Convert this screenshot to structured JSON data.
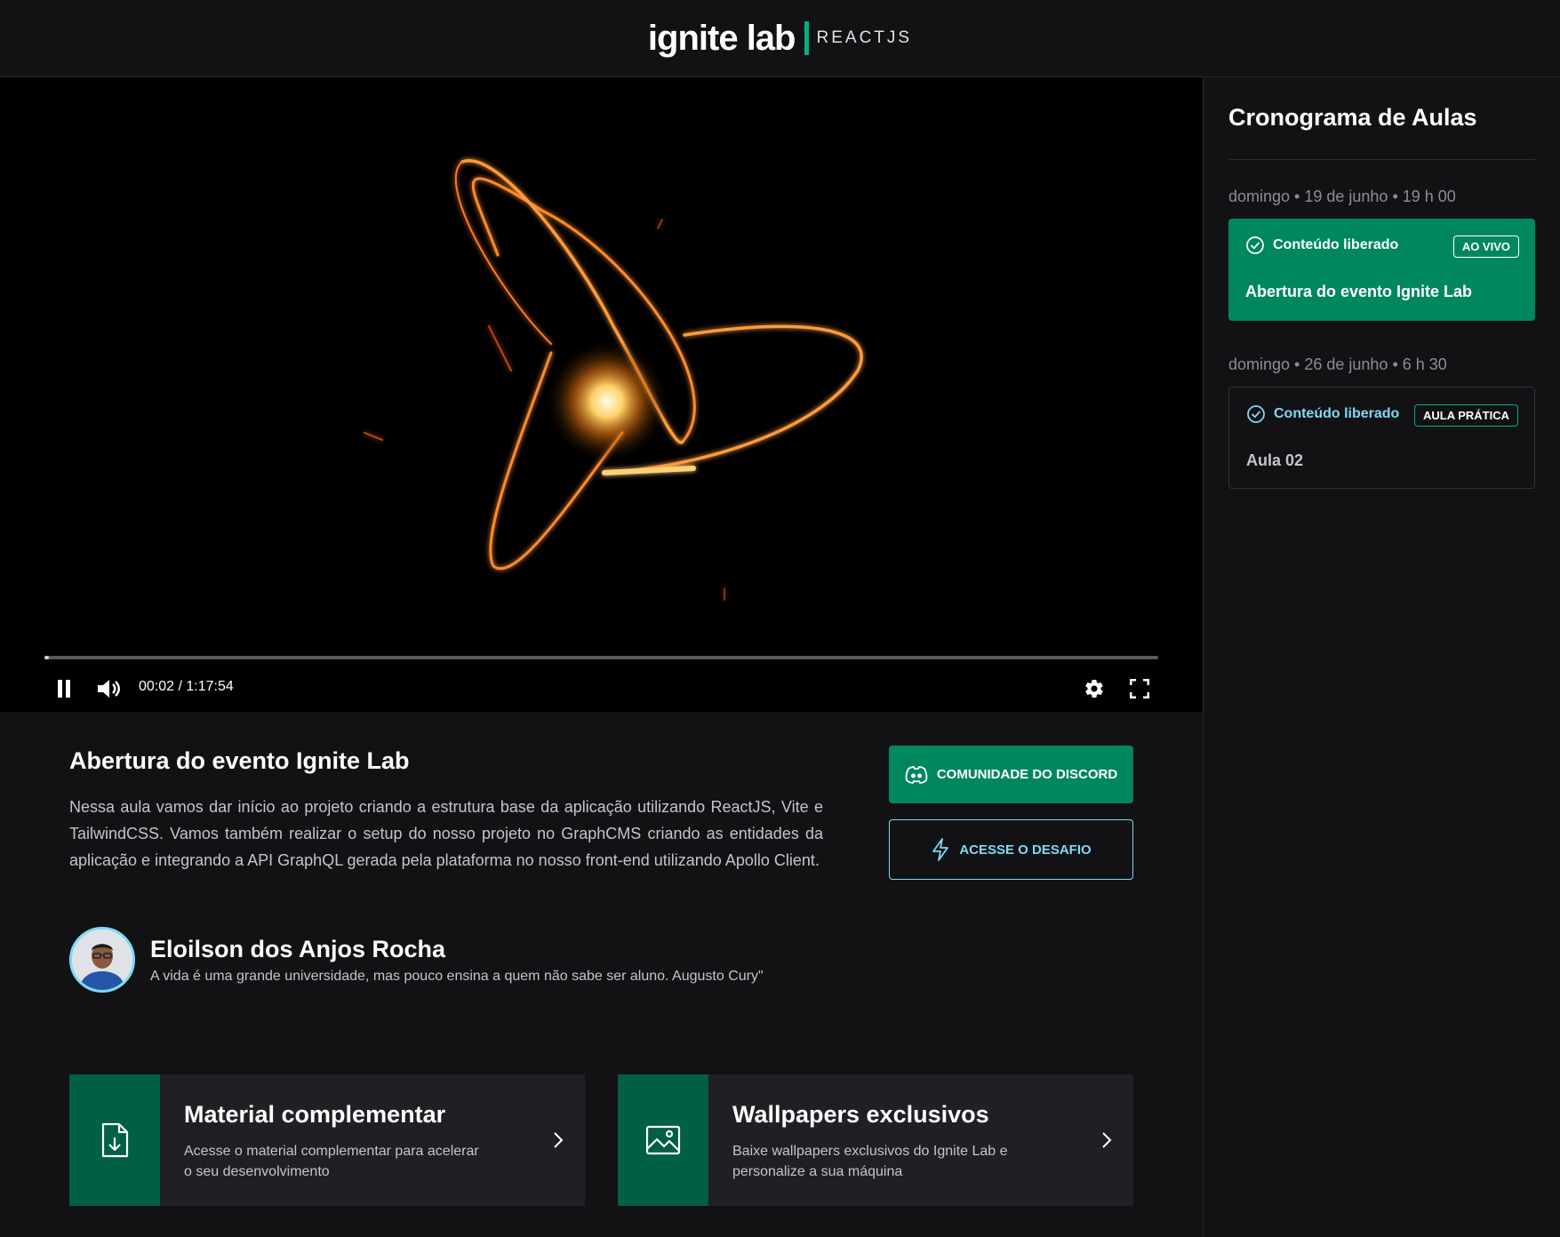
{
  "header": {
    "logo_main": "ignite lab",
    "logo_sub": "REACTJS"
  },
  "player": {
    "time_display": "00:02 / 1:17:54",
    "progress_fraction": 0.0003
  },
  "lesson": {
    "title": "Abertura do evento Ignite Lab",
    "description": "Nessa aula vamos dar início ao projeto criando a estrutura base da aplicação utilizando ReactJS, Vite e TailwindCSS. Vamos também realizar o setup do nosso projeto no GraphCMS criando as entidades da aplicação e integrando a API GraphQL gerada pela plataforma no nosso front-end utilizando Apollo Client."
  },
  "actions": {
    "discord_label": "COMUNIDADE DO DISCORD",
    "challenge_label": "ACESSE O DESAFIO"
  },
  "teacher": {
    "name": "Eloilson dos Anjos Rocha",
    "bio": "A vida é uma grande universidade, mas pouco ensina a quem não sabe ser aluno. Augusto Cury\""
  },
  "cards": [
    {
      "title": "Material complementar",
      "description": "Acesse o material complementar para acelerar o seu desenvolvimento",
      "icon": "file-download-icon"
    },
    {
      "title": "Wallpapers exclusivos",
      "description": "Baixe wallpapers exclusivos do Ignite Lab e personalize a sua máquina",
      "icon": "image-icon"
    }
  ],
  "sidebar": {
    "title": "Cronograma de Aulas",
    "lessons": [
      {
        "date": "domingo • 19 de junho • 19 h 00",
        "status": "Conteúdo liberado",
        "badge": "AO VIVO",
        "name": "Abertura do evento Ignite Lab",
        "active": true
      },
      {
        "date": "domingo • 26 de junho • 6 h 30",
        "status": "Conteúdo liberado",
        "badge": "AULA PRÁTICA",
        "name": "Aula 02",
        "active": false
      }
    ]
  },
  "colors": {
    "green": "#00875f",
    "green_dark": "#015f43",
    "blue": "#81d8f7",
    "background": "#121214"
  }
}
